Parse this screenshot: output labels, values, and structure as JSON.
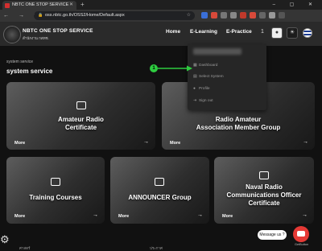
{
  "browser": {
    "tab_title": "NBTC ONE STOP SERVICE",
    "url": "oss.nbtc.go.th/OSS2/Home/Default.aspx",
    "new_tab": "+",
    "window_controls": "– ▢ ✕",
    "nav_buttons": "← → ⟳"
  },
  "site": {
    "brand_title": "NBTC ONE STOP SERVICE",
    "brand_subtitle": "สำนักงาน กสทช.",
    "nav": {
      "home": "Home",
      "elearning": "E-Learning",
      "epractice": "E-Practice"
    },
    "nav_counter": "1"
  },
  "dropdown": {
    "items": [
      {
        "label": "Dashboard",
        "icon": "dashboard-icon"
      },
      {
        "label": "Select System",
        "icon": "select-icon"
      },
      {
        "label": "Profile",
        "icon": "profile-icon"
      },
      {
        "label": "Sign out",
        "icon": "signout-icon"
      }
    ]
  },
  "annotation": {
    "badge": "1",
    "color": "#2ecc40"
  },
  "page": {
    "eyebrow": "system service",
    "title": "system service"
  },
  "cards": [
    {
      "title_line1": "Amateur Radio",
      "title_line2": "Certificate",
      "more": "More",
      "icon": "certificate-icon"
    },
    {
      "title_line1": "Radio Amateur",
      "title_line2": "Association Member Group",
      "more": "More",
      "icon": "group-icon"
    },
    {
      "title_line1": "Training Courses",
      "title_line2": "",
      "more": "More",
      "icon": "training-icon"
    },
    {
      "title_line1": "ANNOUNCER Group",
      "title_line2": "",
      "more": "More",
      "icon": "announcer-icon"
    },
    {
      "title_line1": "Naval Radio",
      "title_line2": "Communications Officer Certificate",
      "more": "More",
      "icon": "naval-icon"
    }
  ],
  "chat": {
    "label": "Message us ?",
    "powered": "GetButton"
  },
  "footer": {
    "left": "ศาสตร์",
    "center": "ประกาศ"
  },
  "colors": {
    "accent": "#2ecc40",
    "chat": "#e53935",
    "header": "#2a2a2a",
    "background": "#111111"
  }
}
